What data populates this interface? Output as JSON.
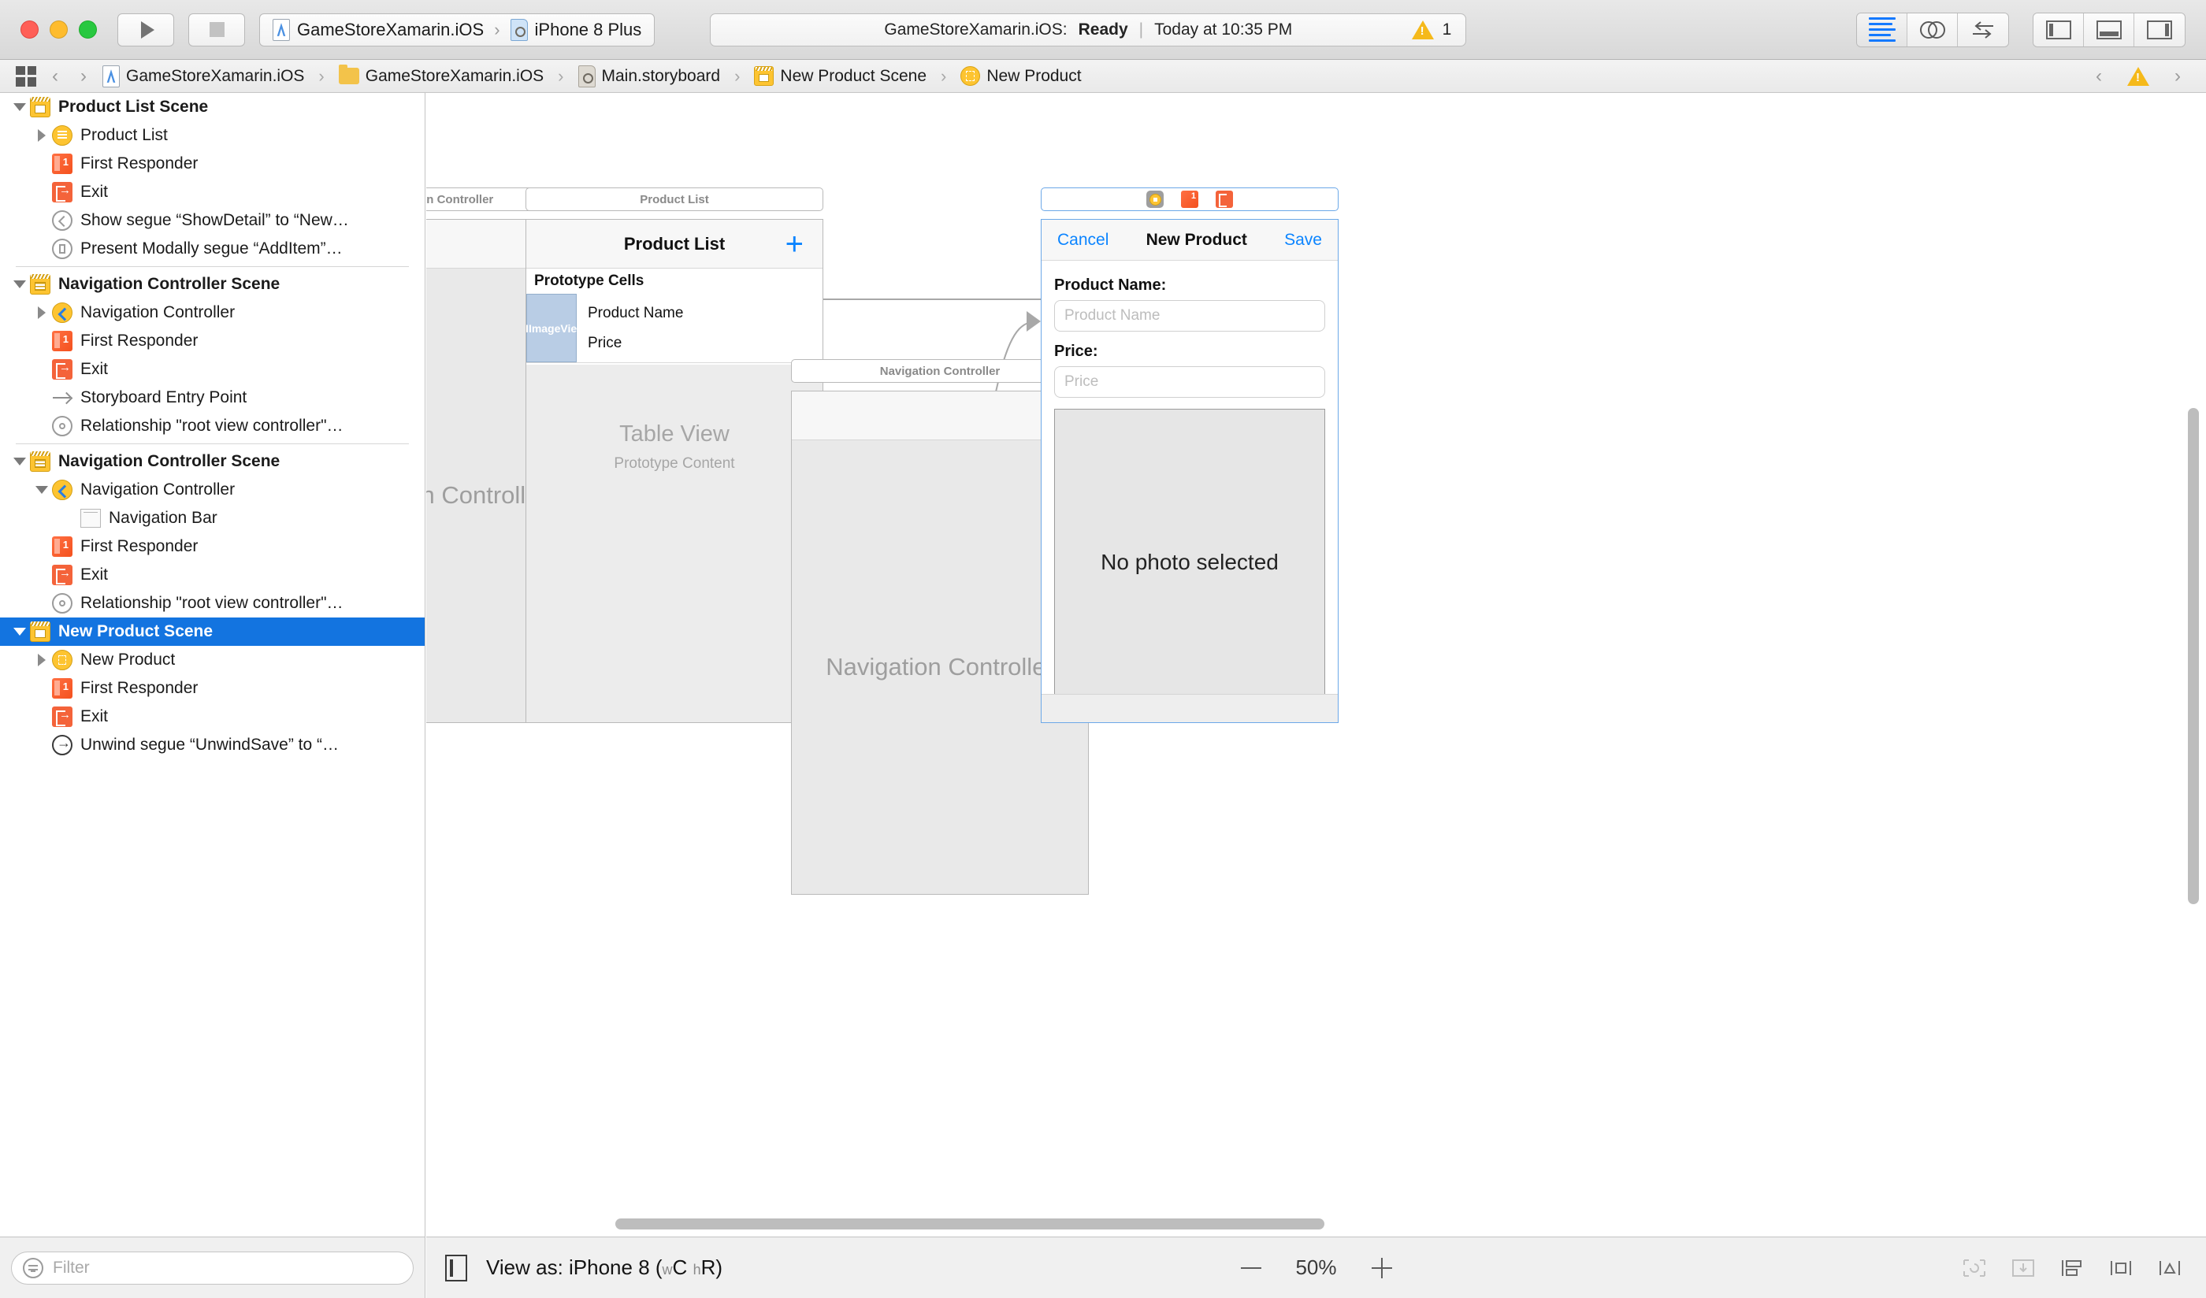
{
  "toolbar": {
    "window_controls": [
      "close",
      "minimize",
      "zoom"
    ],
    "run_label": "Run",
    "stop_label": "Stop",
    "scheme_project": "GameStoreXamarin.iOS",
    "scheme_device": "iPhone 8 Plus",
    "status_project": "GameStoreXamarin.iOS:",
    "status_state": "Ready",
    "status_time": "Today at 10:35 PM",
    "warning_count": "1",
    "editor_buttons": [
      "standard-editor",
      "assistant-editor",
      "version-editor"
    ],
    "panel_buttons": [
      "toggle-navigator",
      "toggle-debug-area",
      "toggle-utilities"
    ]
  },
  "breadcrumb": {
    "items": [
      {
        "label": "GameStoreXamarin.iOS",
        "icon": "xcodeproj-icon"
      },
      {
        "label": "GameStoreXamarin.iOS",
        "icon": "folder-icon"
      },
      {
        "label": "Main.storyboard",
        "icon": "storyboard-icon"
      },
      {
        "label": "New Product Scene",
        "icon": "scene-icon"
      },
      {
        "label": "New Product",
        "icon": "view-controller-icon"
      }
    ],
    "nav_back": "‹",
    "nav_forward": "›",
    "issue_prev": "‹",
    "issue_next": "›",
    "issue_count_icon": "warning-triangle-icon"
  },
  "sidebar": {
    "filter_placeholder": "Filter",
    "rows": [
      {
        "label": "Product List Scene",
        "indent": 0,
        "icon": "scene-icon",
        "twisty": "down",
        "bold": true,
        "selected": false
      },
      {
        "label": "Product List",
        "indent": 1,
        "icon": "table-view-controller-icon",
        "twisty": "right",
        "bold": false,
        "selected": false
      },
      {
        "label": "First Responder",
        "indent": 1,
        "icon": "first-responder-icon",
        "twisty": "none",
        "bold": false,
        "selected": false
      },
      {
        "label": "Exit",
        "indent": 1,
        "icon": "exit-icon",
        "twisty": "none",
        "bold": false,
        "selected": false
      },
      {
        "label": "Show segue “ShowDetail” to “New…",
        "indent": 1,
        "icon": "show-segue-icon",
        "twisty": "none",
        "bold": false,
        "selected": false
      },
      {
        "label": "Present Modally segue “AddItem”…",
        "indent": 1,
        "icon": "modal-segue-icon",
        "twisty": "none",
        "bold": false,
        "selected": false
      },
      {
        "separator": true
      },
      {
        "label": "Navigation Controller Scene",
        "indent": 0,
        "icon": "nav-scene-icon",
        "twisty": "down",
        "bold": true,
        "selected": false
      },
      {
        "label": "Navigation Controller",
        "indent": 1,
        "icon": "navigation-controller-icon",
        "twisty": "right",
        "bold": false,
        "selected": false
      },
      {
        "label": "First Responder",
        "indent": 1,
        "icon": "first-responder-icon",
        "twisty": "none",
        "bold": false,
        "selected": false
      },
      {
        "label": "Exit",
        "indent": 1,
        "icon": "exit-icon",
        "twisty": "none",
        "bold": false,
        "selected": false
      },
      {
        "label": "Storyboard Entry Point",
        "indent": 1,
        "icon": "entry-point-icon",
        "twisty": "none",
        "bold": false,
        "selected": false
      },
      {
        "label": "Relationship \"root view controller\"…",
        "indent": 1,
        "icon": "relationship-icon",
        "twisty": "none",
        "bold": false,
        "selected": false
      },
      {
        "separator": true
      },
      {
        "label": "Navigation Controller Scene",
        "indent": 0,
        "icon": "nav-scene-icon",
        "twisty": "down",
        "bold": true,
        "selected": false
      },
      {
        "label": "Navigation Controller",
        "indent": 1,
        "icon": "navigation-controller-icon",
        "twisty": "down",
        "bold": false,
        "selected": false
      },
      {
        "label": "Navigation Bar",
        "indent": 2,
        "icon": "navigation-bar-icon",
        "twisty": "none",
        "bold": false,
        "selected": false
      },
      {
        "label": "First Responder",
        "indent": 1,
        "icon": "first-responder-icon",
        "twisty": "none",
        "bold": false,
        "selected": false
      },
      {
        "label": "Exit",
        "indent": 1,
        "icon": "exit-icon",
        "twisty": "none",
        "bold": false,
        "selected": false
      },
      {
        "label": "Relationship \"root view controller\"…",
        "indent": 1,
        "icon": "relationship-icon",
        "twisty": "none",
        "bold": false,
        "selected": false
      },
      {
        "label": "New Product Scene",
        "indent": 0,
        "icon": "scene-icon",
        "twisty": "down",
        "bold": true,
        "selected": true
      },
      {
        "label": "New Product",
        "indent": 1,
        "icon": "view-controller-icon",
        "twisty": "right",
        "bold": false,
        "selected": false
      },
      {
        "label": "First Responder",
        "indent": 1,
        "icon": "first-responder-icon",
        "twisty": "none",
        "bold": false,
        "selected": false
      },
      {
        "label": "Exit",
        "indent": 1,
        "icon": "exit-icon",
        "twisty": "none",
        "bold": false,
        "selected": false
      },
      {
        "label": "Unwind segue “UnwindSave” to “…",
        "indent": 1,
        "icon": "unwind-segue-icon",
        "twisty": "none",
        "bold": false,
        "selected": false
      }
    ]
  },
  "canvas": {
    "nav_controller_1": {
      "bar_title": "Navigation Controller",
      "body_label": "Navigation Controller"
    },
    "nav_controller_2": {
      "bar_title": "Navigation Controller",
      "body_label": "Navigation Controller"
    },
    "product_list": {
      "bar_title": "Product List",
      "nav_title": "Product List",
      "add_button": "+",
      "prototype_header": "Prototype Cells",
      "cell_image_label": "UIImageView",
      "cell_title": "Product Name",
      "cell_subtitle": "Price",
      "table_title": "Table View",
      "table_subtitle": "Prototype Content"
    },
    "new_product": {
      "cancel_label": "Cancel",
      "title_label": "New Product",
      "save_label": "Save",
      "name_label": "Product Name:",
      "name_placeholder": "Product Name",
      "price_label": "Price:",
      "price_placeholder": "Price",
      "photo_label": "No photo selected"
    }
  },
  "bottombar": {
    "view_as_prefix": "View as: iPhone 8 (",
    "view_as_w": "w",
    "view_as_wval": "C",
    "view_as_h": "h",
    "view_as_hval": "R)",
    "zoom_out": "—",
    "zoom_value": "50%",
    "zoom_in": "+",
    "right_icons": [
      "update-frames-icon",
      "resolve-auto-layout-icon",
      "align-icon",
      "add-constraints-icon",
      "resolve-issues-icon"
    ]
  },
  "colors": {
    "accent_blue": "#1374e0",
    "ios_blue": "#0b84ff",
    "warning_yellow": "#f5b91a",
    "scene_yellow": "#fdc431",
    "exit_orange": "#f4633a"
  }
}
